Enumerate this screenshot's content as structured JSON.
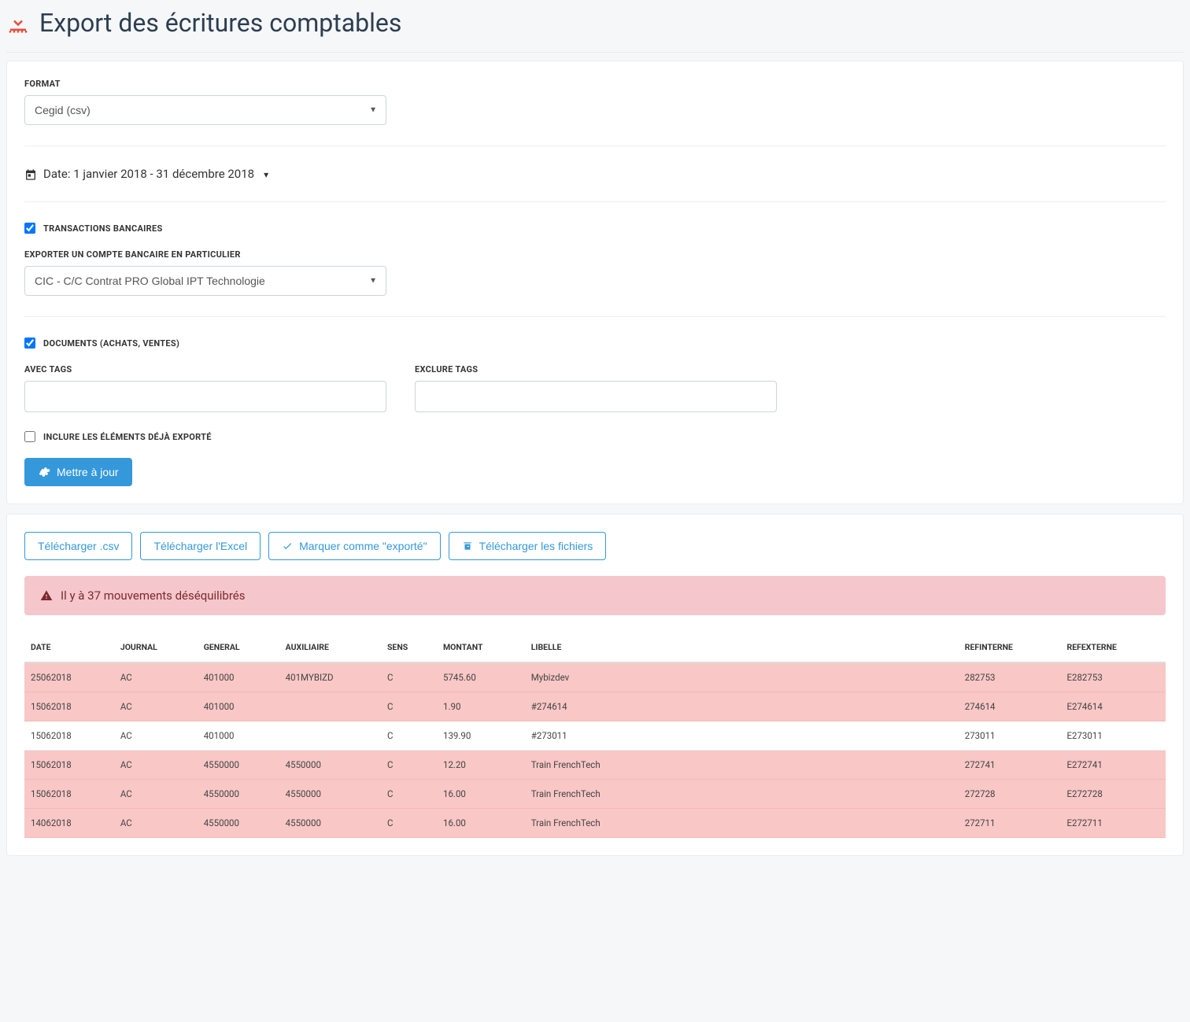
{
  "header": {
    "title": "Export des écritures comptables"
  },
  "form": {
    "format_label": "FORMAT",
    "format_value": "Cegid (csv)",
    "date_label": "Date: 1 janvier 2018 - 31 décembre 2018",
    "transactions_checkbox_label": "TRANSACTIONS BANCAIRES",
    "bank_account_label": "EXPORTER UN COMPTE BANCAIRE EN PARTICULIER",
    "bank_account_value": "CIC - C/C Contrat PRO Global IPT Technologie",
    "documents_checkbox_label": "DOCUMENTS (ACHATS, VENTES)",
    "with_tags_label": "AVEC TAGS",
    "exclude_tags_label": "EXCLURE TAGS",
    "include_exported_label": "INCLURE LES ÉLÉMENTS DÉJÀ EXPORTÉ",
    "update_button": "Mettre à jour"
  },
  "actions": {
    "download_csv": "Télécharger .csv",
    "download_excel": "Télécharger l'Excel",
    "mark_exported": "Marquer comme \"exporté\"",
    "download_files": "Télécharger les fichiers"
  },
  "alert": {
    "text": "Il y à 37 mouvements déséquilibrés"
  },
  "table": {
    "headers": {
      "date": "DATE",
      "journal": "JOURNAL",
      "general": "GENERAL",
      "auxiliaire": "AUXILIAIRE",
      "sens": "SENS",
      "montant": "MONTANT",
      "libelle": "LIBELLE",
      "refinterne": "REFINTERNE",
      "refexterne": "REFEXTERNE"
    },
    "rows": [
      {
        "date": "25062018",
        "journal": "AC",
        "general": "401000",
        "auxiliaire": "401MYBIZD",
        "sens": "C",
        "montant": "5745.60",
        "libelle": "Mybizdev",
        "refinterne": "282753",
        "refexterne": "E282753",
        "highlight": true
      },
      {
        "date": "15062018",
        "journal": "AC",
        "general": "401000",
        "auxiliaire": "",
        "sens": "C",
        "montant": "1.90",
        "libelle": "#274614",
        "refinterne": "274614",
        "refexterne": "E274614",
        "highlight": true
      },
      {
        "date": "15062018",
        "journal": "AC",
        "general": "401000",
        "auxiliaire": "",
        "sens": "C",
        "montant": "139.90",
        "libelle": "#273011",
        "refinterne": "273011",
        "refexterne": "E273011",
        "highlight": false
      },
      {
        "date": "15062018",
        "journal": "AC",
        "general": "4550000",
        "auxiliaire": "4550000",
        "sens": "C",
        "montant": "12.20",
        "libelle": "Train FrenchTech",
        "refinterne": "272741",
        "refexterne": "E272741",
        "highlight": true
      },
      {
        "date": "15062018",
        "journal": "AC",
        "general": "4550000",
        "auxiliaire": "4550000",
        "sens": "C",
        "montant": "16.00",
        "libelle": "Train FrenchTech",
        "refinterne": "272728",
        "refexterne": "E272728",
        "highlight": true
      },
      {
        "date": "14062018",
        "journal": "AC",
        "general": "4550000",
        "auxiliaire": "4550000",
        "sens": "C",
        "montant": "16.00",
        "libelle": "Train FrenchTech",
        "refinterne": "272711",
        "refexterne": "E272711",
        "highlight": true
      }
    ]
  }
}
